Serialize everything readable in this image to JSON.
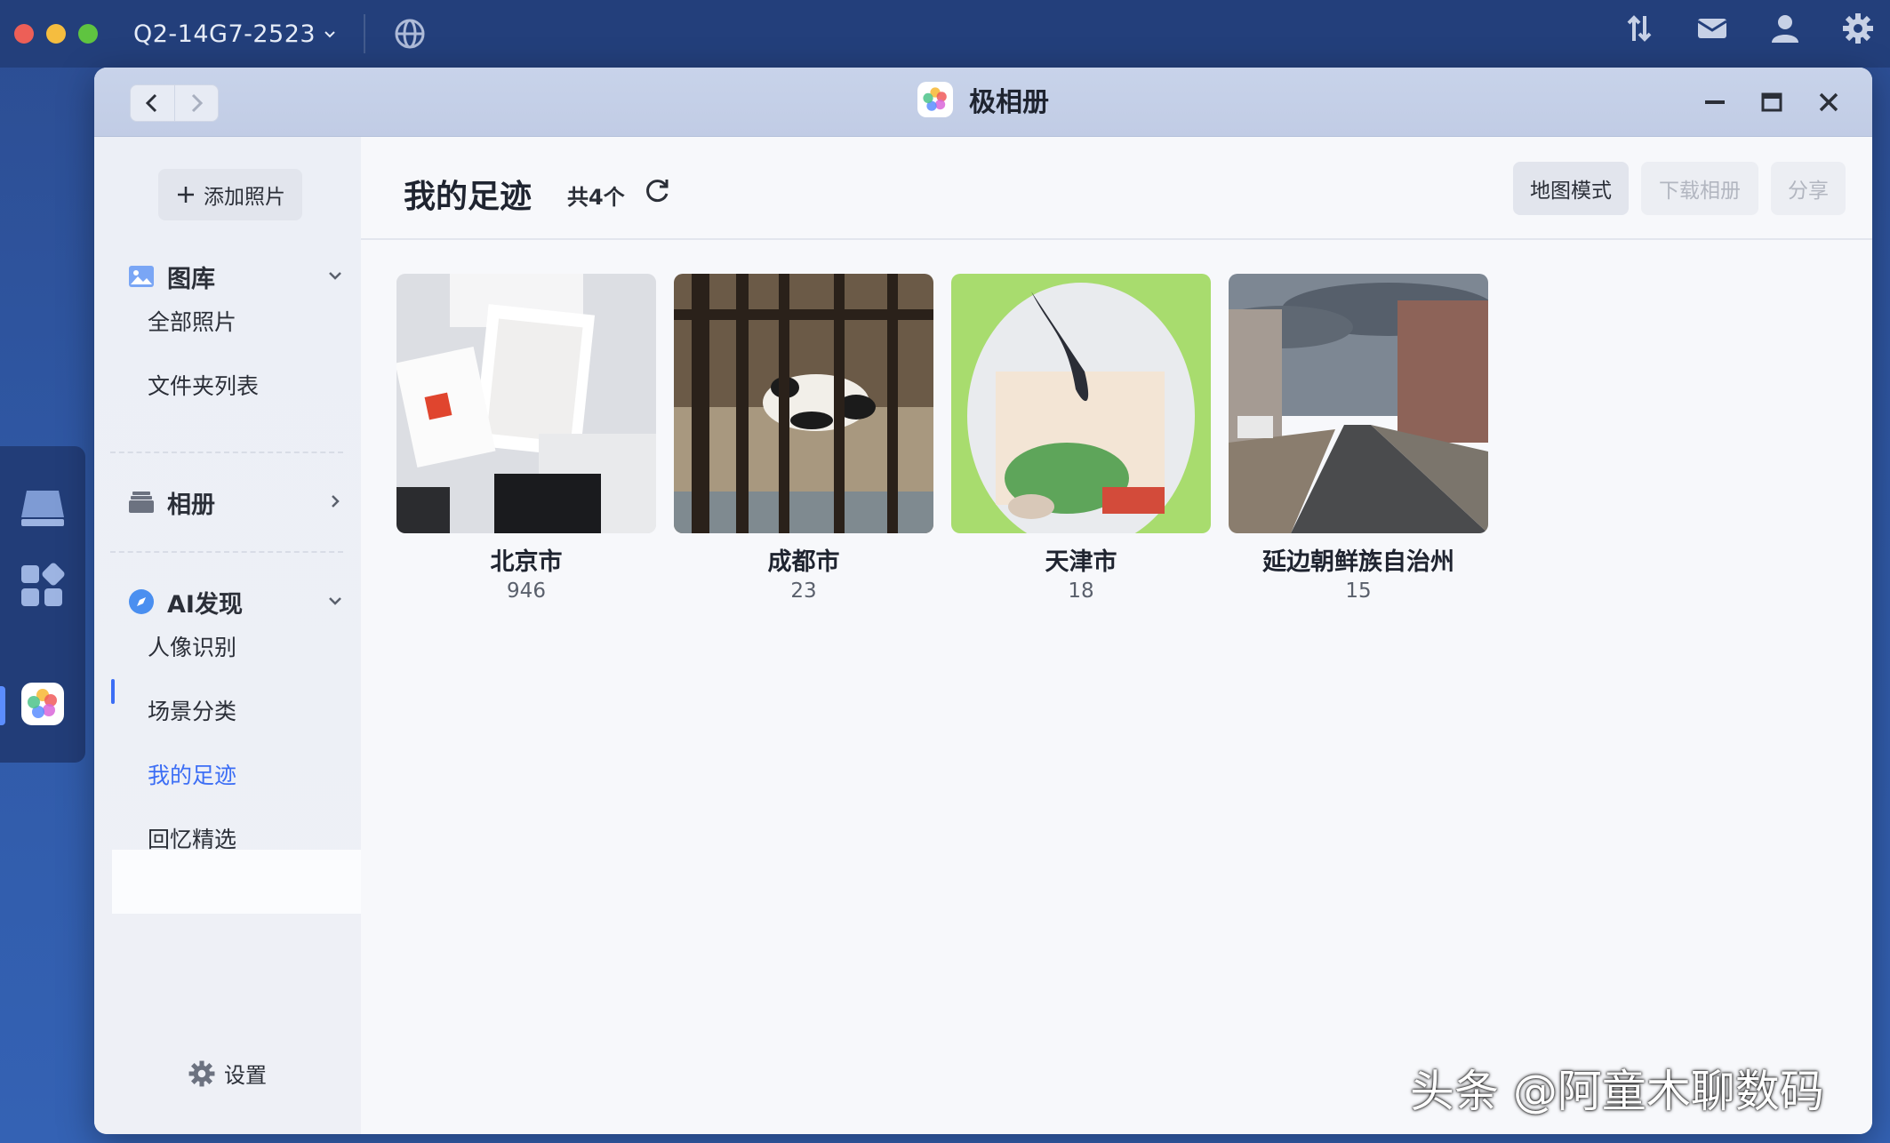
{
  "topbar": {
    "device_name": "Q2-14G7-2523",
    "icons": [
      "transfer-icon",
      "mail-icon",
      "user-icon",
      "settings-icon"
    ]
  },
  "window": {
    "title": "极相册"
  },
  "sidebar": {
    "add_label": "添加照片",
    "sections": [
      {
        "label": "图库",
        "items": [
          "全部照片",
          "文件夹列表"
        ]
      },
      {
        "label": "相册",
        "items": []
      },
      {
        "label": "AI发现",
        "items": [
          "人像识别",
          "场景分类",
          "我的足迹",
          "回忆精选"
        ]
      }
    ],
    "active_item": "我的足迹",
    "settings_label": "设置"
  },
  "main": {
    "title": "我的足迹",
    "count": "共4个",
    "buttons": {
      "map": "地图模式",
      "download": "下载相册",
      "share": "分享"
    },
    "places": [
      {
        "name": "北京市",
        "count": "946"
      },
      {
        "name": "成都市",
        "count": "23"
      },
      {
        "name": "天津市",
        "count": "18"
      },
      {
        "name": "延边朝鲜族自治州",
        "count": "15"
      }
    ]
  },
  "watermark": "头条 @阿童木聊数码",
  "colors": {
    "accent": "#3c6ef5",
    "desktop": "#2f57a3"
  }
}
